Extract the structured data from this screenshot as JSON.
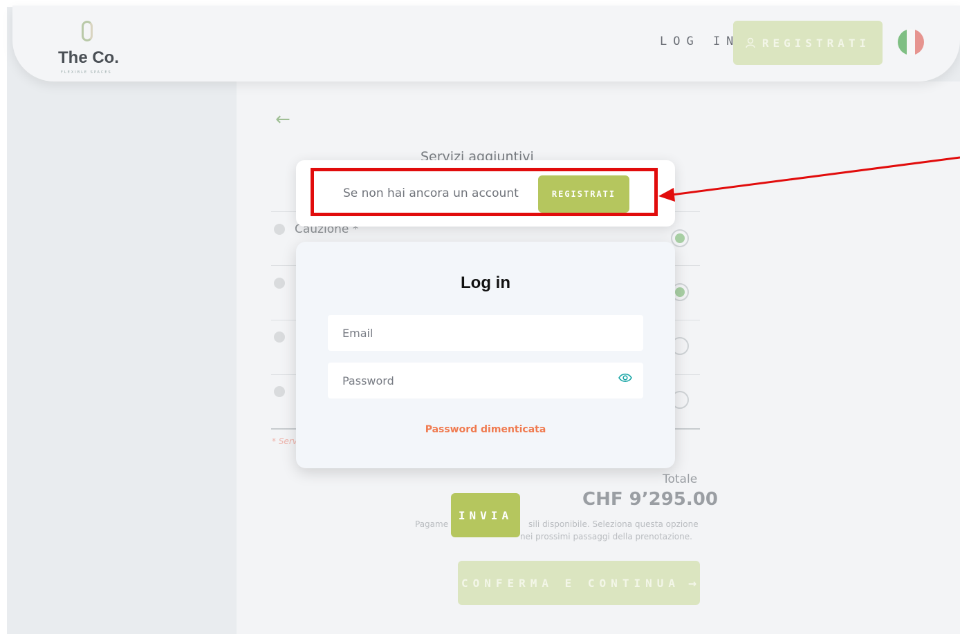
{
  "header": {
    "logo": {
      "name": "The Co.",
      "tagline": "FLEXIBLE SPACES"
    },
    "login_label": "LOG IN",
    "register_label": "REGISTRATI",
    "language_flag": "italy-flag-icon"
  },
  "background": {
    "section_title": "Servizi aggiuntivi",
    "caution_label": "Cauzione *",
    "required_note": "* Serv",
    "total_label": "Totale",
    "total_value": "CHF 9’295.00",
    "payment_note_1": "Pagame",
    "payment_note_2": "sili disponibile. Seleziona questa opzione",
    "payment_note_3": "nei prossimi passaggi della prenotazione.",
    "submit_label": "INVIA",
    "confirm_label": "CONFERMA E CONTINUA"
  },
  "register_card": {
    "text": "Se non hai ancora un account",
    "button_label": "REGISTRATI"
  },
  "login_card": {
    "title": "Log in",
    "email_placeholder": "Email",
    "password_placeholder": "Password",
    "forgot_label": "Password dimenticata"
  },
  "colors": {
    "accent_green": "#b5c65e",
    "highlight_red": "#e10c0c",
    "forgot_orange": "#f07a4f",
    "eye_teal": "#1aa6a6"
  }
}
